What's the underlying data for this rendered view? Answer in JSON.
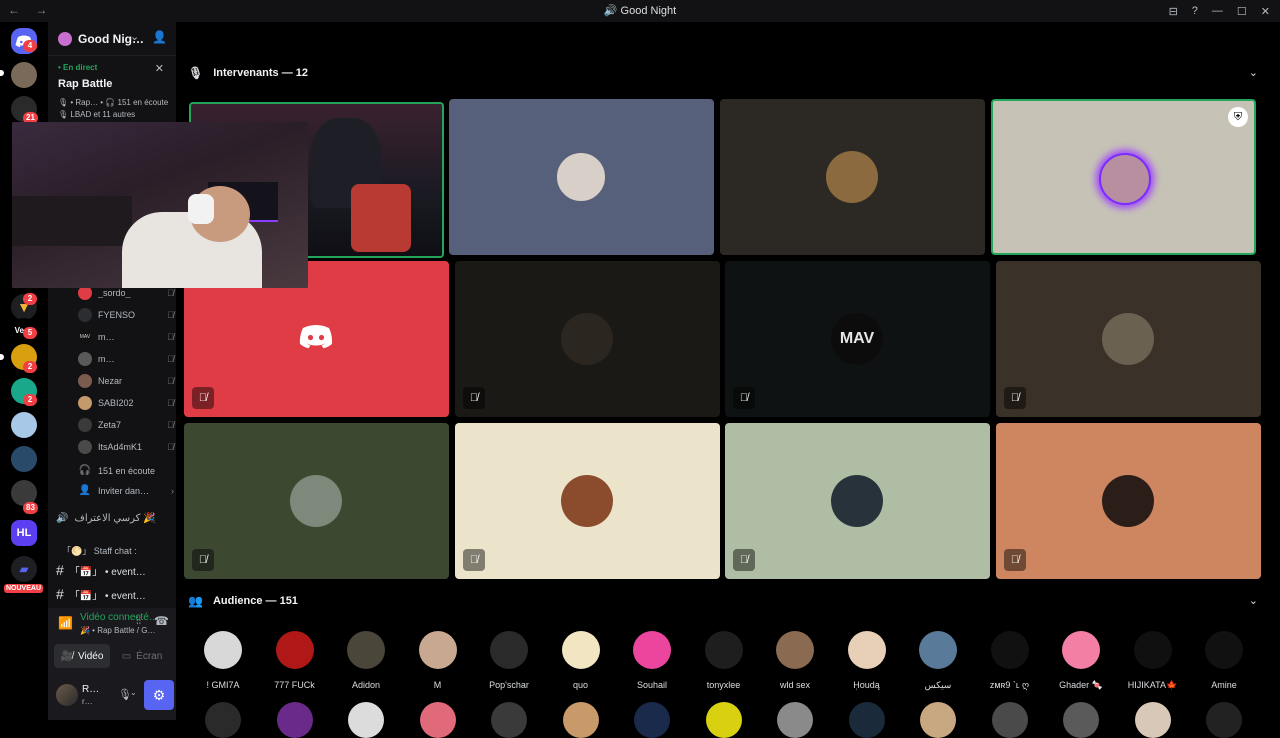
{
  "window": {
    "title": "Good Night",
    "nav": [
      "←",
      "→"
    ],
    "controls": [
      "⊟",
      "?",
      "—",
      "☐",
      "✕"
    ]
  },
  "serverbar": {
    "badges": [
      "4",
      "21",
      "2",
      "5",
      "2",
      "2",
      "83"
    ],
    "vega_label": "Vega",
    "hl_label": "HL",
    "new_label": "NOUVEAU"
  },
  "server": {
    "name": "Good Nig…",
    "live": {
      "badge": "• En direct",
      "title": "Rap Battle",
      "meta": "🎙 • Rap… • 🎧 151 en écoute",
      "meta2": "🎙 LBAD et 11 autres"
    },
    "members": [
      {
        "name": "_sordo_",
        "color": "#e03c46"
      },
      {
        "name": "FYENSO",
        "color": "#2b2d31"
      },
      {
        "name": "m…",
        "color": "#111"
      },
      {
        "name": "m…",
        "color": "#5a5a5a"
      },
      {
        "name": "Nezar",
        "color": "#7a5c4e"
      },
      {
        "name": "SABI202",
        "color": "#c49a6c"
      },
      {
        "name": "Zeta7",
        "color": "#3a3a3a"
      },
      {
        "name": "ItsAd4mK1",
        "color": "#4a4a4a"
      }
    ],
    "listening": "151 en écoute",
    "invite": "Inviter dan…",
    "channels": [
      {
        "label": "كرسي الاعتراف 🎉",
        "icon": "🔊"
      },
      {
        "label": "「🌕」 Staff chat :",
        "icon": ""
      },
      {
        "label": "「📅」 • event…",
        "icon": "#"
      },
      {
        "label": "「📅」 • event…",
        "icon": "#"
      }
    ]
  },
  "voice": {
    "status": "Vidéo connecté…",
    "path": "🎉 • Rap Battle / G…",
    "video_label": "Vidéo",
    "screen_label": "Écran"
  },
  "user": {
    "name": "R…",
    "sub": "r…"
  },
  "stage": {
    "speakers_label": "Intervenants — 12",
    "audience_label": "Audience — 151",
    "tiles": [
      {
        "bg": "#1b1620",
        "speaking": true,
        "video": true,
        "muted": false
      },
      {
        "bg": "#56607a",
        "speaking": false,
        "av": "#d8d0c8",
        "muted": false
      },
      {
        "bg": "#2c2823",
        "speaking": false,
        "av": "#8a6a3e",
        "muted": false
      },
      {
        "bg": "#c6c3b6",
        "speaking": true,
        "av": "#b78fa0",
        "muted": false,
        "mod": true
      },
      {
        "bg": "#e03c46",
        "speaking": false,
        "discord": true,
        "muted": true
      },
      {
        "bg": "#1a1915",
        "speaking": false,
        "av": "#2b2620",
        "muted": true
      },
      {
        "bg": "#0f1212",
        "speaking": false,
        "av": "#0c0c0c",
        "text": "MAV",
        "muted": true
      },
      {
        "bg": "#3a3128",
        "speaking": false,
        "av": "#6b6150",
        "muted": true
      },
      {
        "bg": "#3d4830",
        "speaking": false,
        "av": "#7d8a7b",
        "muted": true
      },
      {
        "bg": "#ece3cb",
        "speaking": false,
        "av": "#8a4c2c",
        "muted": true
      },
      {
        "bg": "#aebda3",
        "speaking": false,
        "av": "#27323a",
        "muted": true
      },
      {
        "bg": "#cd8660",
        "speaking": false,
        "av": "#2b1e18",
        "muted": true
      }
    ],
    "audience": [
      {
        "name": "! GMI7A",
        "color": "#d8d8d8"
      },
      {
        "name": "777 FUCk",
        "color": "#b01818"
      },
      {
        "name": "Adidon",
        "color": "#4a463a"
      },
      {
        "name": "M",
        "color": "#c8a890"
      },
      {
        "name": "Pop'schar",
        "color": "#2a2a2a"
      },
      {
        "name": "quo",
        "color": "#f2e6c2"
      },
      {
        "name": "Souhail",
        "color": "#eb459e"
      },
      {
        "name": "tonyxlee",
        "color": "#1e1e1e"
      },
      {
        "name": "wld sex",
        "color": "#8a6a50"
      },
      {
        "name": "Ḥoudą",
        "color": "#e8d0b8"
      },
      {
        "name": "سيكس",
        "color": "#5a7a9a"
      },
      {
        "name": "ᴢᴍʀ9 `ʟ ღ",
        "color": "#111"
      },
      {
        "name": "Ghader 🍬",
        "color": "#f47fa4"
      },
      {
        "name": "HIJIKATA🍁",
        "color": "#101010"
      },
      {
        "name": "Amine",
        "color": "#111"
      }
    ],
    "audience_row2_colors": [
      "#2a2a2a",
      "#6a2a8a",
      "#dcdcdc",
      "#e06a7a",
      "#3a3a3a",
      "#c89a6a",
      "#1a2a4a",
      "#d8d010",
      "#8a8a8a",
      "#1a2a3a",
      "#c8a880",
      "#4a4a4a",
      "#5a5a5a",
      "#d8c8b8",
      "#222"
    ]
  }
}
